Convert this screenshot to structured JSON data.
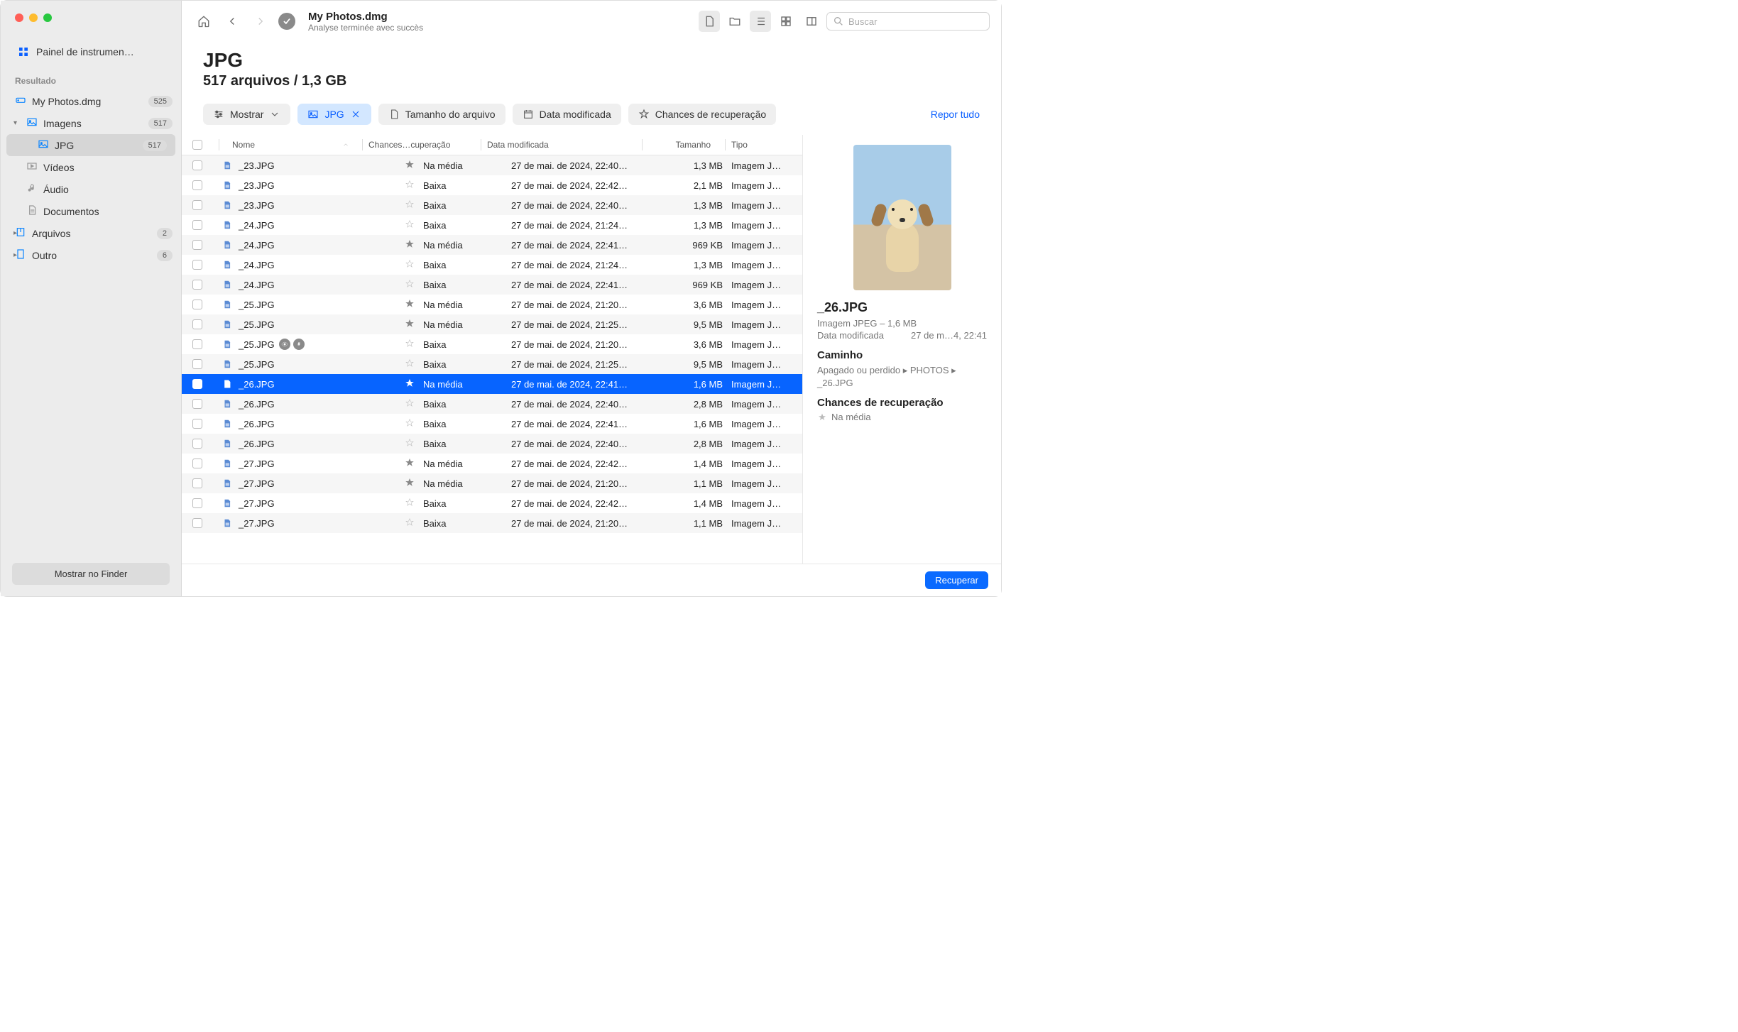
{
  "sidebar": {
    "dashboard": "Painel de instrumen…",
    "sectionLabel": "Resultado",
    "items": [
      {
        "label": "My Photos.dmg",
        "badge": "525",
        "icon": "drive"
      },
      {
        "label": "Imagens",
        "badge": "517",
        "icon": "image",
        "expanded": true
      },
      {
        "label": "JPG",
        "badge": "517",
        "icon": "image",
        "active": true
      },
      {
        "label": "Vídeos",
        "icon": "video"
      },
      {
        "label": "Áudio",
        "icon": "audio"
      },
      {
        "label": "Documentos",
        "icon": "doc"
      },
      {
        "label": "Arquivos",
        "badge": "2",
        "icon": "archive",
        "chev": true
      },
      {
        "label": "Outro",
        "badge": "6",
        "icon": "other",
        "chev": true
      }
    ],
    "footerBtn": "Mostrar no Finder"
  },
  "toolbar": {
    "title": "My Photos.dmg",
    "subtitle": "Analyse terminée avec succès",
    "searchPlaceholder": "Buscar"
  },
  "heading": {
    "title": "JPG",
    "subtitle": "517 arquivos / 1,3 GB"
  },
  "filters": {
    "show": "Mostrar",
    "jpg": "JPG",
    "size": "Tamanho do arquivo",
    "date": "Data modificada",
    "chances": "Chances de recuperação",
    "reset": "Repor tudo"
  },
  "columns": {
    "name": "Nome",
    "rec": "Chances…cuperação",
    "date": "Data modificada",
    "size": "Tamanho",
    "type": "Tipo"
  },
  "rows": [
    {
      "name": "_23.JPG",
      "rec": "Na média",
      "recLvl": 1,
      "date": "27 de mai. de 2024, 22:40…",
      "size": "1,3 MB",
      "type": "Imagem J…"
    },
    {
      "name": "_23.JPG",
      "rec": "Baixa",
      "recLvl": 0,
      "date": "27 de mai. de 2024, 22:42…",
      "size": "2,1 MB",
      "type": "Imagem J…"
    },
    {
      "name": "_23.JPG",
      "rec": "Baixa",
      "recLvl": 0,
      "date": "27 de mai. de 2024, 22:40…",
      "size": "1,3 MB",
      "type": "Imagem J…"
    },
    {
      "name": "_24.JPG",
      "rec": "Baixa",
      "recLvl": 0,
      "date": "27 de mai. de 2024, 21:24…",
      "size": "1,3 MB",
      "type": "Imagem J…"
    },
    {
      "name": "_24.JPG",
      "rec": "Na média",
      "recLvl": 1,
      "date": "27 de mai. de 2024, 22:41…",
      "size": "969 KB",
      "type": "Imagem J…"
    },
    {
      "name": "_24.JPG",
      "rec": "Baixa",
      "recLvl": 0,
      "date": "27 de mai. de 2024, 21:24…",
      "size": "1,3 MB",
      "type": "Imagem J…"
    },
    {
      "name": "_24.JPG",
      "rec": "Baixa",
      "recLvl": 0,
      "date": "27 de mai. de 2024, 22:41…",
      "size": "969 KB",
      "type": "Imagem J…"
    },
    {
      "name": "_25.JPG",
      "rec": "Na média",
      "recLvl": 1,
      "date": "27 de mai. de 2024, 21:20…",
      "size": "3,6 MB",
      "type": "Imagem J…"
    },
    {
      "name": "_25.JPG",
      "rec": "Na média",
      "recLvl": 1,
      "date": "27 de mai. de 2024, 21:25…",
      "size": "9,5 MB",
      "type": "Imagem J…"
    },
    {
      "name": "_25.JPG",
      "rec": "Baixa",
      "recLvl": 0,
      "date": "27 de mai. de 2024, 21:20…",
      "size": "3,6 MB",
      "type": "Imagem J…",
      "actions": true
    },
    {
      "name": "_25.JPG",
      "rec": "Baixa",
      "recLvl": 0,
      "date": "27 de mai. de 2024, 21:25…",
      "size": "9,5 MB",
      "type": "Imagem J…"
    },
    {
      "name": "_26.JPG",
      "rec": "Na média",
      "recLvl": 1,
      "date": "27 de mai. de 2024, 22:41…",
      "size": "1,6 MB",
      "type": "Imagem J…",
      "selected": true
    },
    {
      "name": "_26.JPG",
      "rec": "Baixa",
      "recLvl": 0,
      "date": "27 de mai. de 2024, 22:40…",
      "size": "2,8 MB",
      "type": "Imagem J…"
    },
    {
      "name": "_26.JPG",
      "rec": "Baixa",
      "recLvl": 0,
      "date": "27 de mai. de 2024, 22:41…",
      "size": "1,6 MB",
      "type": "Imagem J…"
    },
    {
      "name": "_26.JPG",
      "rec": "Baixa",
      "recLvl": 0,
      "date": "27 de mai. de 2024, 22:40…",
      "size": "2,8 MB",
      "type": "Imagem J…"
    },
    {
      "name": "_27.JPG",
      "rec": "Na média",
      "recLvl": 1,
      "date": "27 de mai. de 2024, 22:42…",
      "size": "1,4 MB",
      "type": "Imagem J…"
    },
    {
      "name": "_27.JPG",
      "rec": "Na média",
      "recLvl": 1,
      "date": "27 de mai. de 2024, 21:20…",
      "size": "1,1 MB",
      "type": "Imagem J…"
    },
    {
      "name": "_27.JPG",
      "rec": "Baixa",
      "recLvl": 0,
      "date": "27 de mai. de 2024, 22:42…",
      "size": "1,4 MB",
      "type": "Imagem J…"
    },
    {
      "name": "_27.JPG",
      "rec": "Baixa",
      "recLvl": 0,
      "date": "27 de mai. de 2024, 21:20…",
      "size": "1,1 MB",
      "type": "Imagem J…"
    }
  ],
  "details": {
    "name": "_26.JPG",
    "sub": "Imagem JPEG – 1,6 MB",
    "modLabel": "Data modificada",
    "modValue": "27 de m…4, 22:41",
    "pathLabel": "Caminho",
    "path": "Apagado ou perdido ▸ PHOTOS ▸ _26.JPG",
    "recLabel": "Chances de recuperação",
    "recValue": "Na média"
  },
  "footer": {
    "recover": "Recuperar"
  }
}
